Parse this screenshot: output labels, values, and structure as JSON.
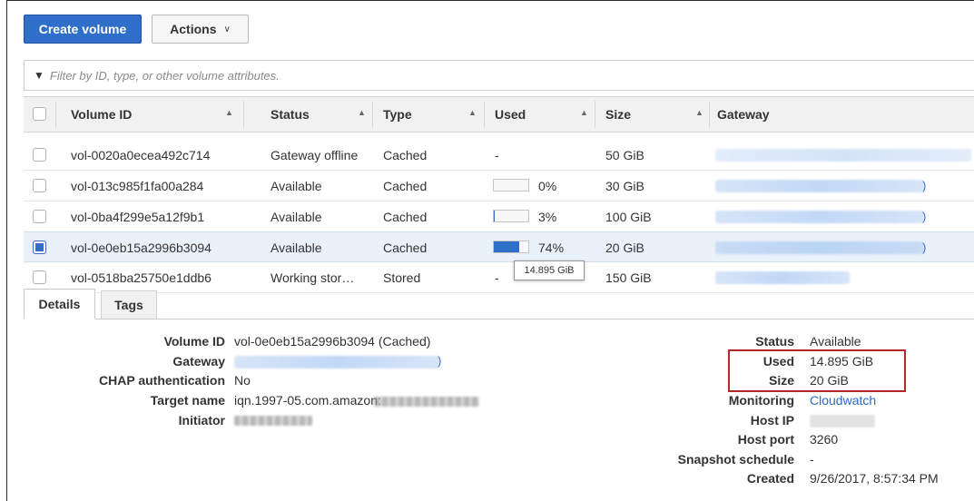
{
  "toolbar": {
    "create_label": "Create volume",
    "actions_label": "Actions"
  },
  "filter": {
    "placeholder": "Filter by ID, type, or other volume attributes."
  },
  "table": {
    "headers": {
      "volume_id": "Volume ID",
      "status": "Status",
      "type": "Type",
      "used": "Used",
      "size": "Size",
      "gateway": "Gateway"
    },
    "rows": [
      {
        "volume_id": "vol-0020a0ecea492c714",
        "status": "Gateway offline",
        "type": "Cached",
        "used": "-",
        "size": "50 GiB"
      },
      {
        "volume_id": "vol-013c985f1fa00a284",
        "status": "Available",
        "type": "Cached",
        "used": "0%",
        "used_fraction": 0.0,
        "size": "30 GiB"
      },
      {
        "volume_id": "vol-0ba4f299e5a12f9b1",
        "status": "Available",
        "type": "Cached",
        "used": "3%",
        "used_fraction": 0.03,
        "size": "100 GiB"
      },
      {
        "volume_id": "vol-0e0eb15a2996b3094",
        "status": "Available",
        "type": "Cached",
        "used": "74%",
        "used_fraction": 0.74,
        "size": "20 GiB",
        "selected": true
      },
      {
        "volume_id": "vol-0518ba25750e1ddb6",
        "status": "Working stor…",
        "type": "Stored",
        "used": "-",
        "size": "150 GiB"
      }
    ],
    "tooltip": "14.895 GiB"
  },
  "tabs": {
    "details": "Details",
    "tags": "Tags"
  },
  "details": {
    "left": {
      "volume_id_label": "Volume ID",
      "volume_id_value": "vol-0e0eb15a2996b3094 (Cached)",
      "gateway_label": "Gateway",
      "chap_label": "CHAP authentication",
      "chap_value": "No",
      "target_label": "Target name",
      "target_value": "iqn.1997-05.com.amazon:",
      "initiator_label": "Initiator"
    },
    "right": {
      "status_label": "Status",
      "status_value": "Available",
      "used_label": "Used",
      "used_value": "14.895 GiB",
      "size_label": "Size",
      "size_value": "20 GiB",
      "monitoring_label": "Monitoring",
      "monitoring_value": "Cloudwatch",
      "host_ip_label": "Host IP",
      "host_port_label": "Host port",
      "host_port_value": "3260",
      "snapshot_label": "Snapshot schedule",
      "snapshot_value": "-",
      "created_label": "Created",
      "created_value": "9/26/2017, 8:57:34 PM"
    }
  },
  "colors": {
    "primary": "#2f6fc9",
    "link": "#2a6bc6",
    "highlight_box": "#b3262a"
  }
}
